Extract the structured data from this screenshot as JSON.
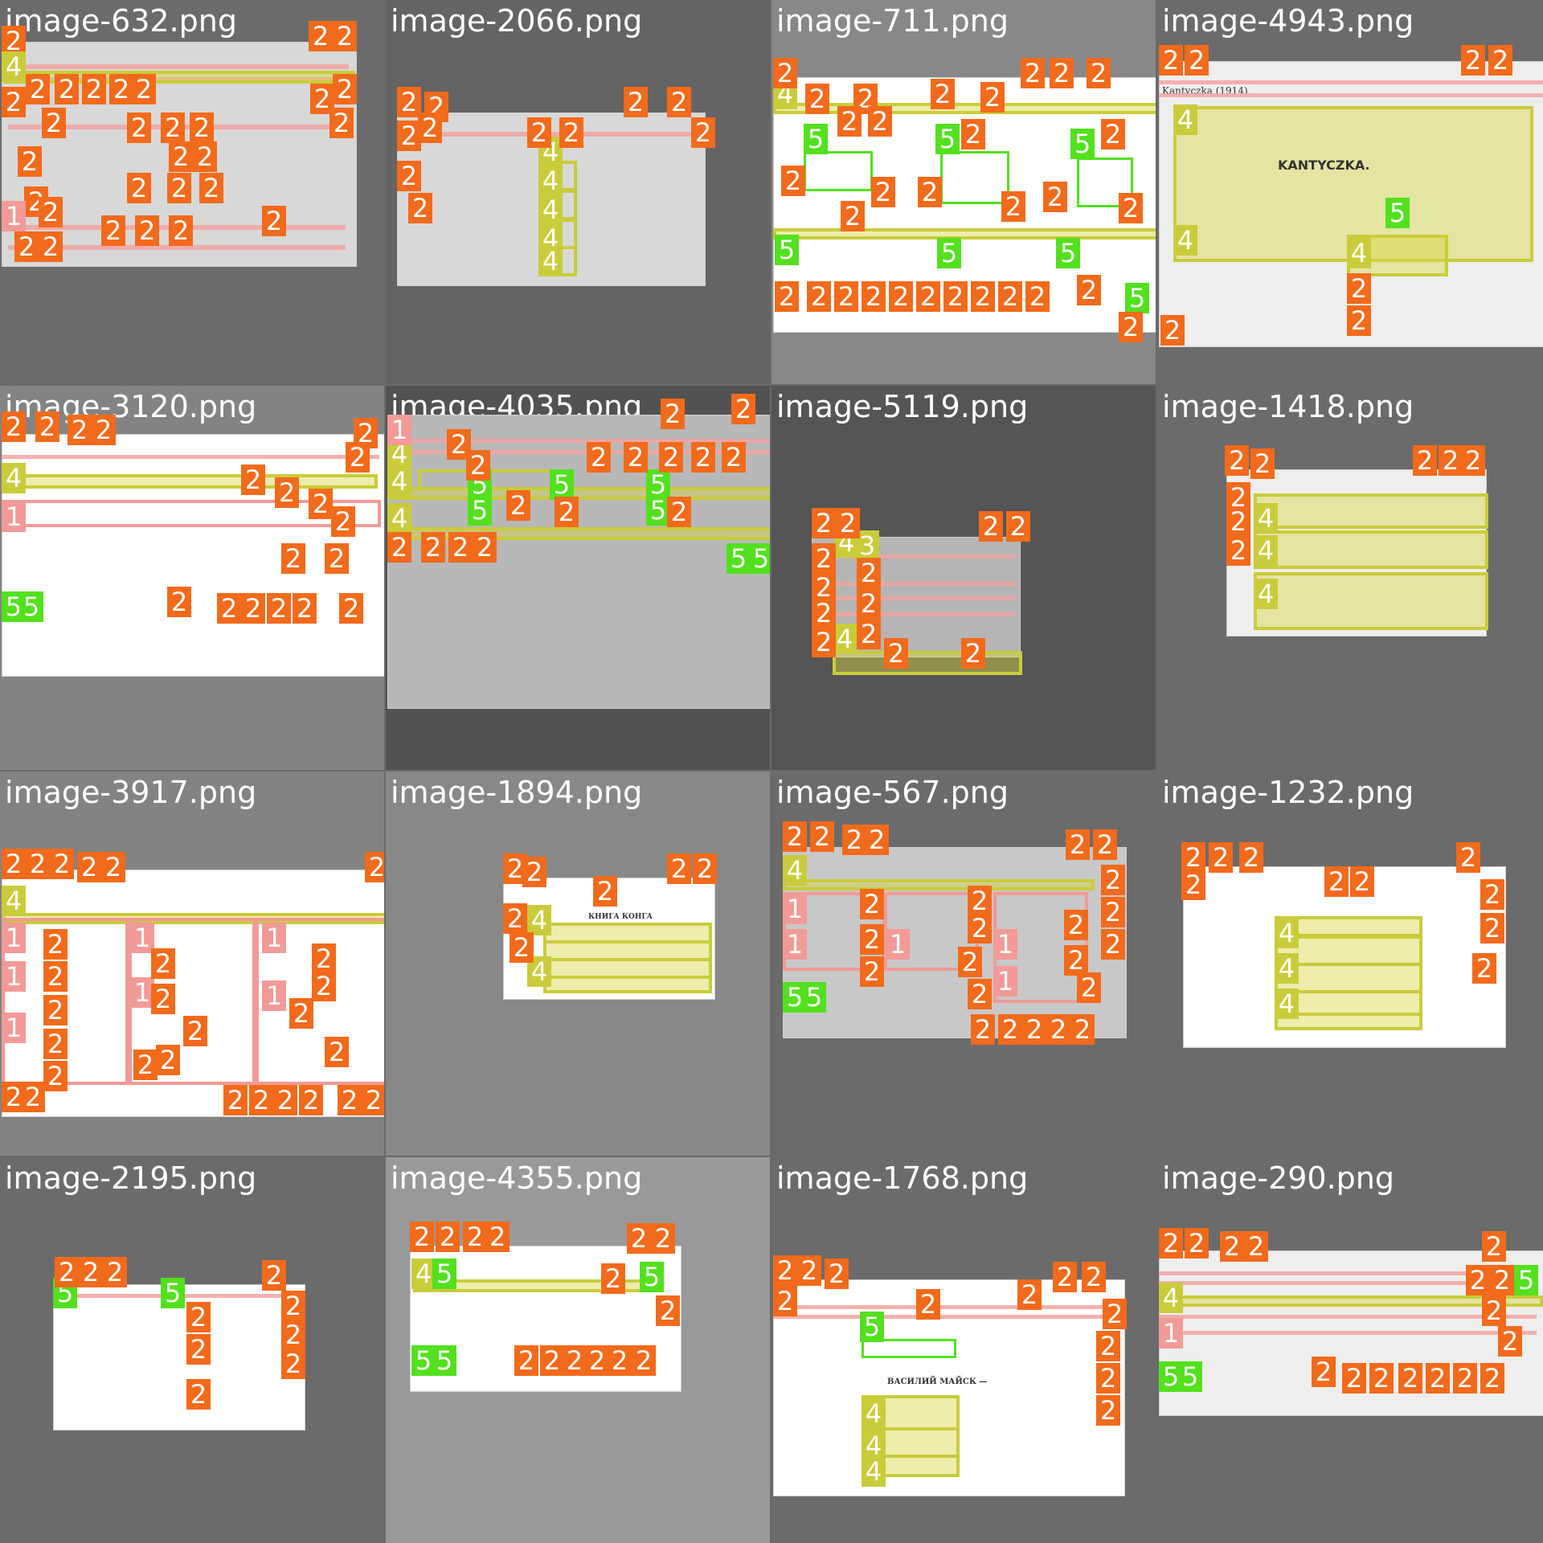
{
  "tiles": [
    {
      "title": "image-632.png"
    },
    {
      "title": "image-2066.png"
    },
    {
      "title": "image-711.png"
    },
    {
      "title": "image-4943.png"
    },
    {
      "title": "image-3120.png"
    },
    {
      "title": "image-4035.png"
    },
    {
      "title": "image-5119.png"
    },
    {
      "title": "image-1418.png"
    },
    {
      "title": "image-3917.png"
    },
    {
      "title": "image-1894.png"
    },
    {
      "title": "image-567.png"
    },
    {
      "title": "image-1232.png"
    },
    {
      "title": "image-2195.png"
    },
    {
      "title": "image-4355.png"
    },
    {
      "title": "image-1768.png"
    },
    {
      "title": "image-290.png"
    }
  ],
  "badge_labels": {
    "one": "1",
    "two": "2",
    "three": "3",
    "four": "4",
    "five": "5"
  },
  "page_headings": {
    "kantyczka_title": "Kantyczka (1914)",
    "kantyczka_heading": "KANTYCZKA.",
    "kniga_heading": "КНИГА КОНГА",
    "vasily_heading": "ВАСИЛИЙ МАЙСК —"
  },
  "colors": {
    "orange": "#f26a1b",
    "yellow": "#c9cc3a",
    "green": "#53e01e",
    "pink": "#f29a97"
  }
}
